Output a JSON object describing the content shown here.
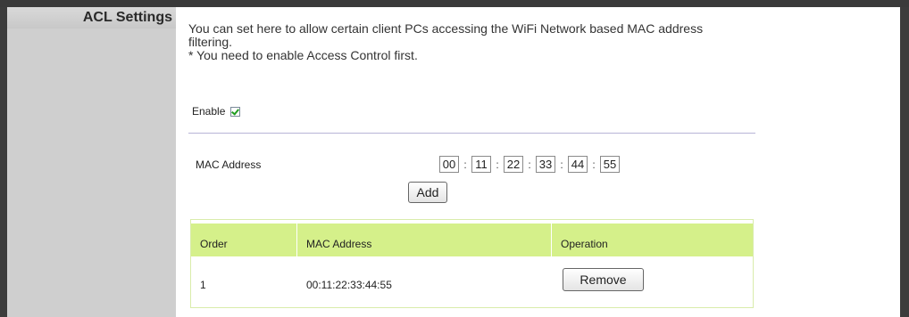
{
  "sidebar": {
    "title": "ACL Settings"
  },
  "description": {
    "line1": "You can set here to allow certain client PCs accessing the WiFi Network based MAC address",
    "line2": "filtering.",
    "line3": "* You need to enable Access Control first."
  },
  "enable": {
    "label": "Enable",
    "checked": true
  },
  "mac": {
    "label": "MAC Address",
    "octets": [
      "00",
      "11",
      "22",
      "33",
      "44",
      "55"
    ],
    "separator": ":",
    "add_label": "Add"
  },
  "table": {
    "headers": [
      "Order",
      "MAC Address",
      "Operation"
    ],
    "rows": [
      {
        "order": "1",
        "mac": "00:11:22:33:44:55",
        "action_label": "Remove"
      }
    ]
  },
  "colors": {
    "table_header": "#d5f08a",
    "sidebar": "#cfcfcf",
    "checkmark": "#1f9c1f"
  }
}
